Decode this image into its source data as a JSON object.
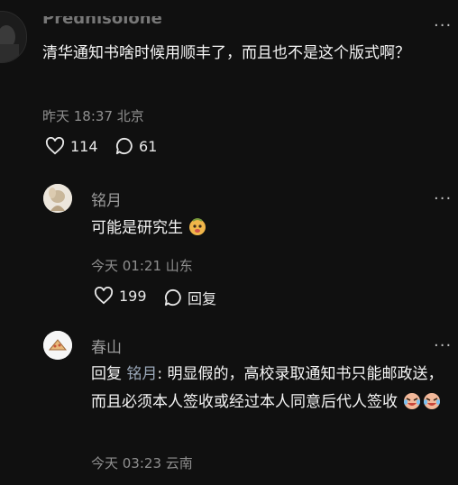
{
  "top_comment": {
    "username": "Prednisolone",
    "text": "清华通知书啥时候用顺丰了，而且也不是这个版式啊？",
    "time_location": "昨天 18:37 北京",
    "likes": "114",
    "replies": "61",
    "more_icon": "more-dots-icon"
  },
  "reply1": {
    "username": "铭月",
    "text": "可能是研究生",
    "time_location": "今天 01:21 山东",
    "likes": "199",
    "reply_label": "回复",
    "emoji": "pumpkin-face-emoji"
  },
  "reply2": {
    "username": "春山",
    "reply_prefix": "回复 ",
    "reply_to": "铭月",
    "text": ": 明显假的，高校录取通知书只能邮政送，而且必须本人签收或经过本人同意后代人签收",
    "time_location": "今天 03:23 云南",
    "emoji": "laughing-cry-emoji"
  },
  "colors": {
    "background": "#101010",
    "text": "#f5f5f5",
    "secondary": "#8f8f8f"
  }
}
